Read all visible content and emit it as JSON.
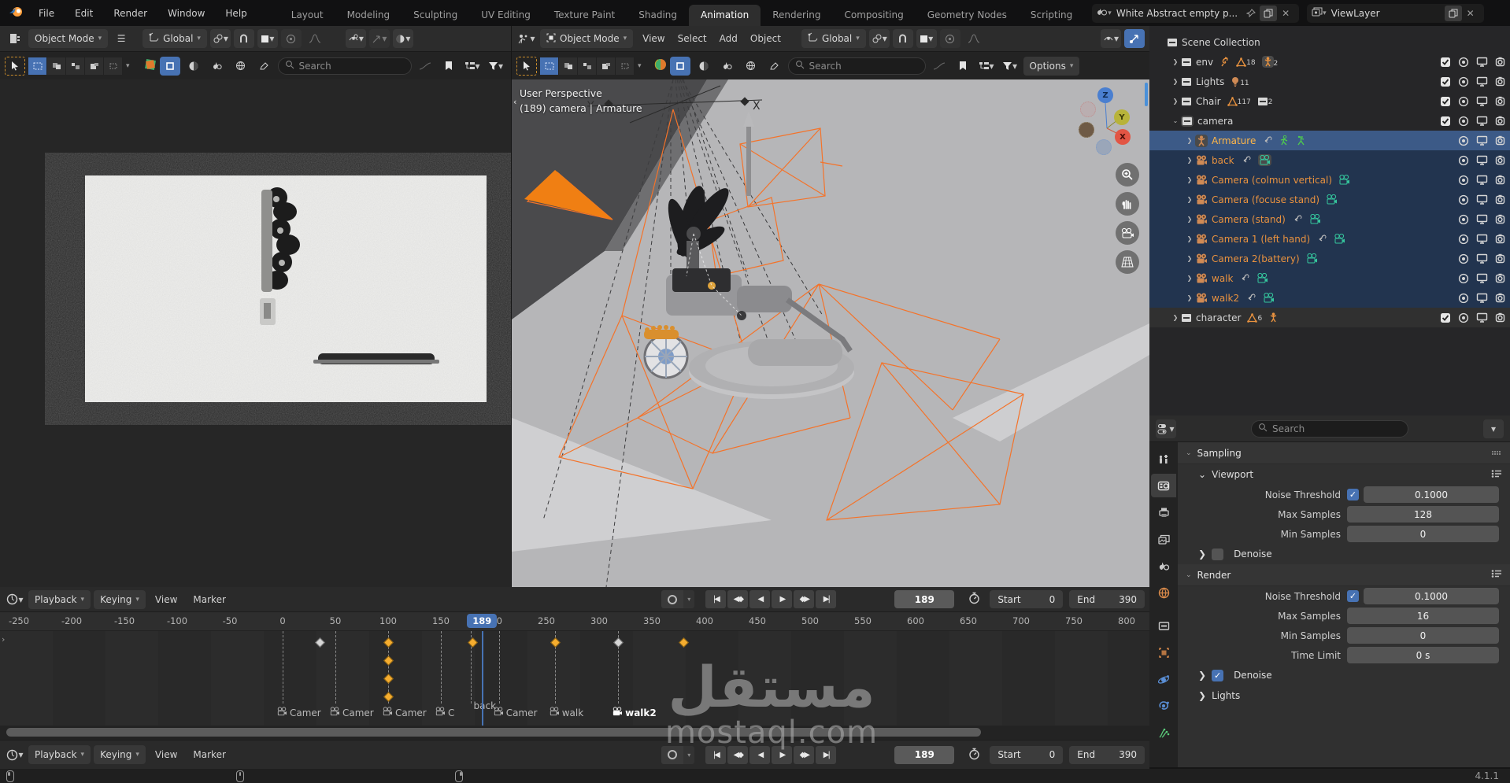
{
  "topbar": {
    "menus": [
      "File",
      "Edit",
      "Render",
      "Window",
      "Help"
    ],
    "tabs": [
      "Layout",
      "Modeling",
      "Sculpting",
      "UV Editing",
      "Texture Paint",
      "Shading",
      "Animation",
      "Rendering",
      "Compositing",
      "Geometry Nodes",
      "Scripting"
    ],
    "active_tab": "Animation",
    "scene_name": "White Abstract empty p...",
    "view_layer_name": "ViewLayer"
  },
  "left_viewport": {
    "mode": "Object Mode",
    "orientation": "Global",
    "search_placeholder": "Search"
  },
  "center_viewport": {
    "mode": "Object Mode",
    "menus": [
      "View",
      "Select",
      "Add",
      "Object"
    ],
    "orientation": "Global",
    "options_label": "Options",
    "search_placeholder": "Search",
    "overlay_line1": "User Perspective",
    "overlay_line2": "(189) camera | Armature",
    "axis": {
      "x": "X",
      "y": "Y",
      "z": "Z"
    }
  },
  "outliner": {
    "search_placeholder": "Search",
    "rows": [
      {
        "indent": 0,
        "chevron": "",
        "icon": "collection",
        "label": "Scene Collection",
        "label_color": "white",
        "badges": [],
        "controls": [],
        "bg": "none"
      },
      {
        "indent": 1,
        "chevron": "right",
        "icon": "collection",
        "label": "env",
        "label_color": "white",
        "badges": [
          {
            "icon": "force-field",
            "count": ""
          },
          {
            "icon": "mesh-data",
            "count": "18"
          },
          {
            "icon": "armature-data",
            "count": "2",
            "boxed": true
          }
        ],
        "controls": [
          "checkbox",
          "selectable",
          "monitor",
          "camera-restrict"
        ],
        "bg": "none"
      },
      {
        "indent": 1,
        "chevron": "right",
        "icon": "collection",
        "label": "Lights",
        "label_color": "white",
        "badges": [
          {
            "icon": "light-data",
            "count": "11"
          }
        ],
        "controls": [
          "checkbox",
          "selectable",
          "monitor",
          "camera-restrict"
        ],
        "bg": "none"
      },
      {
        "indent": 1,
        "chevron": "right",
        "icon": "collection",
        "label": "Chair",
        "label_color": "white",
        "badges": [
          {
            "icon": "mesh-data",
            "count": "117"
          },
          {
            "icon": "collection",
            "count": "2"
          }
        ],
        "controls": [
          "checkbox",
          "selectable",
          "monitor",
          "camera-restrict"
        ],
        "bg": "none"
      },
      {
        "indent": 1,
        "chevron": "down",
        "icon": "collection",
        "icon_boxed": true,
        "label": "camera",
        "label_color": "white",
        "badges": [],
        "controls": [
          "checkbox",
          "selectable",
          "monitor",
          "camera-restrict"
        ],
        "bg": "none"
      },
      {
        "indent": 2,
        "chevron": "right",
        "icon": "armature-obj",
        "icon_boxed": true,
        "label": "Armature",
        "label_color": "active-orange",
        "badges": [
          {
            "icon": "constraint"
          },
          {
            "icon": "pose"
          },
          {
            "icon": "pose2"
          }
        ],
        "controls": [
          "selectable",
          "monitor",
          "camera-restrict"
        ],
        "bg": "active"
      },
      {
        "indent": 2,
        "chevron": "right",
        "icon": "camera-obj",
        "label": "back",
        "label_color": "orange",
        "badges": [
          {
            "icon": "constraint"
          },
          {
            "icon": "camera-data",
            "boxed": true
          }
        ],
        "controls": [
          "selectable",
          "monitor",
          "camera-restrict"
        ],
        "bg": "child"
      },
      {
        "indent": 2,
        "chevron": "right",
        "icon": "camera-obj",
        "label": "Camera (colmun vertical)",
        "label_color": "orange",
        "badges": [
          {
            "icon": "camera-data"
          }
        ],
        "controls": [
          "selectable",
          "monitor",
          "camera-restrict"
        ],
        "bg": "child"
      },
      {
        "indent": 2,
        "chevron": "right",
        "icon": "camera-obj",
        "label": "Camera (focuse stand)",
        "label_color": "orange",
        "badges": [
          {
            "icon": "camera-data"
          }
        ],
        "controls": [
          "selectable",
          "monitor",
          "camera-restrict"
        ],
        "bg": "child"
      },
      {
        "indent": 2,
        "chevron": "right",
        "icon": "camera-obj",
        "label": "Camera (stand)",
        "label_color": "orange",
        "badges": [
          {
            "icon": "constraint"
          },
          {
            "icon": "camera-data"
          }
        ],
        "controls": [
          "selectable",
          "monitor",
          "camera-restrict"
        ],
        "bg": "child"
      },
      {
        "indent": 2,
        "chevron": "right",
        "icon": "camera-obj",
        "label": "Camera 1 (left hand)",
        "label_color": "orange",
        "badges": [
          {
            "icon": "constraint"
          },
          {
            "icon": "camera-data"
          }
        ],
        "controls": [
          "selectable",
          "monitor",
          "camera-restrict"
        ],
        "bg": "child"
      },
      {
        "indent": 2,
        "chevron": "right",
        "icon": "camera-obj",
        "label": "Camera 2(battery)",
        "label_color": "orange",
        "badges": [
          {
            "icon": "camera-data"
          }
        ],
        "controls": [
          "selectable",
          "monitor",
          "camera-restrict"
        ],
        "bg": "child"
      },
      {
        "indent": 2,
        "chevron": "right",
        "icon": "camera-obj",
        "label": "walk",
        "label_color": "orange",
        "badges": [
          {
            "icon": "constraint"
          },
          {
            "icon": "camera-data"
          }
        ],
        "controls": [
          "selectable",
          "monitor",
          "camera-restrict"
        ],
        "bg": "child"
      },
      {
        "indent": 2,
        "chevron": "right",
        "icon": "camera-obj",
        "label": "walk2",
        "label_color": "orange",
        "badges": [
          {
            "icon": "constraint"
          },
          {
            "icon": "camera-data"
          }
        ],
        "controls": [
          "selectable",
          "monitor",
          "camera-restrict"
        ],
        "bg": "child"
      },
      {
        "indent": 1,
        "chevron": "right",
        "icon": "collection",
        "label": "character",
        "label_color": "white",
        "badges": [
          {
            "icon": "mesh-data",
            "count": "6"
          },
          {
            "icon": "armature-data",
            "count": ""
          }
        ],
        "controls": [
          "checkbox",
          "selectable",
          "monitor",
          "camera-restrict"
        ],
        "bg": "dim"
      }
    ]
  },
  "properties": {
    "search_placeholder": "Search",
    "tabs": [
      "tool",
      "render",
      "output",
      "view-layer",
      "scene",
      "world",
      "collection",
      "object",
      "physics",
      "constraints",
      "particles"
    ],
    "active_tab": "render",
    "sampling_label": "Sampling",
    "viewport_label": "Viewport",
    "render_label": "Render",
    "lights_label": "Lights",
    "viewport_rows": [
      {
        "label": "Noise Threshold",
        "checkbox": true,
        "checked": true,
        "value": "0.1000"
      },
      {
        "label": "Max Samples",
        "checkbox": false,
        "value": "128"
      },
      {
        "label": "Min Samples",
        "checkbox": false,
        "value": "0"
      }
    ],
    "viewport_denoise": {
      "label": "Denoise",
      "checked": false
    },
    "render_rows": [
      {
        "label": "Noise Threshold",
        "checkbox": true,
        "checked": true,
        "value": "0.1000"
      },
      {
        "label": "Max Samples",
        "checkbox": false,
        "value": "16"
      },
      {
        "label": "Min Samples",
        "checkbox": false,
        "value": "0"
      },
      {
        "label": "Time Limit",
        "checkbox": false,
        "value": "0 s"
      }
    ],
    "render_denoise": {
      "label": "Denoise",
      "checked": true
    }
  },
  "timeline": {
    "menus": [
      "Playback",
      "Keying",
      "View",
      "Marker"
    ],
    "ticks": [
      -250,
      -200,
      -150,
      -100,
      -50,
      0,
      50,
      100,
      150,
      200,
      250,
      300,
      350,
      400,
      450,
      500,
      550,
      600,
      650,
      700,
      750,
      800
    ],
    "current_frame": "189",
    "current_frame_num": 189,
    "start_label": "Start",
    "start_value": "0",
    "end_label": "End",
    "end_value": "390",
    "markers": [
      {
        "frame": 0,
        "label": "Camer",
        "selected": false
      },
      {
        "frame": 50,
        "label": "Camer",
        "selected": false
      },
      {
        "frame": 100,
        "label": "Camer",
        "selected": false
      },
      {
        "frame": 150,
        "label": "C",
        "selected": false
      },
      {
        "frame": 178,
        "label": "back",
        "raised": true,
        "selected": false
      },
      {
        "frame": 205,
        "label": "Camer",
        "selected": false
      },
      {
        "frame": 258,
        "label": "walk",
        "selected": false
      },
      {
        "frame": 318,
        "label": "walk2",
        "selected": true
      }
    ],
    "keyframes": [
      {
        "frame": 35,
        "row": 0,
        "color": "gray"
      },
      {
        "frame": 100,
        "row": 0,
        "color": "orange"
      },
      {
        "frame": 100,
        "row": 1,
        "color": "orange"
      },
      {
        "frame": 100,
        "row": 2,
        "color": "orange"
      },
      {
        "frame": 100,
        "row": 3,
        "color": "orange"
      },
      {
        "frame": 180,
        "row": 0,
        "color": "orange"
      },
      {
        "frame": 258,
        "row": 0,
        "color": "orange"
      },
      {
        "frame": 318,
        "row": 0,
        "color": "gray"
      },
      {
        "frame": 380,
        "row": 0,
        "color": "orange"
      }
    ]
  },
  "statusbar": {
    "version": "4.1.1"
  },
  "watermark": {
    "arabic": "مستقل",
    "latin": "mostaql.com"
  },
  "colors": {
    "accent_blue": "#4772b3",
    "object_orange": "#e9923f",
    "data_teal": "#35c79e",
    "key_orange": "#f5ad2f"
  }
}
